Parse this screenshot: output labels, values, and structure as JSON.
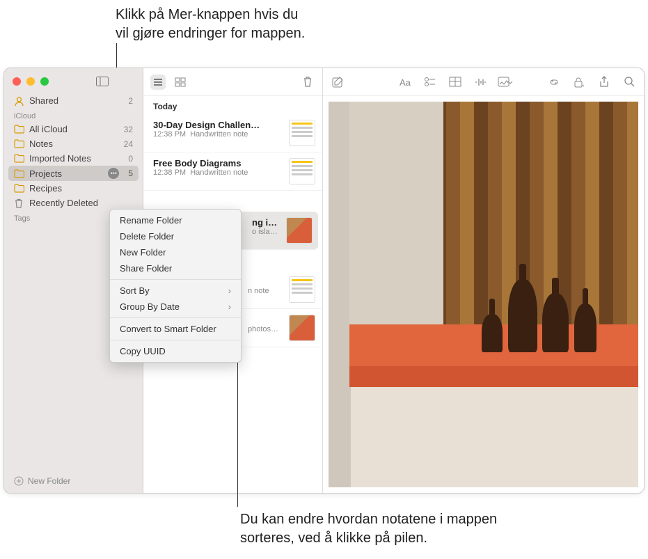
{
  "callouts": {
    "top": "Klikk på Mer-knappen hvis du\nvil gjøre endringer for mappen.",
    "bottom": "Du kan endre hvordan notatene i mappen\nsorteres, ved å klikke på pilen."
  },
  "sidebar": {
    "shared": {
      "label": "Shared",
      "count": "2"
    },
    "section_icloud": "iCloud",
    "items": [
      {
        "label": "All iCloud",
        "count": "32"
      },
      {
        "label": "Notes",
        "count": "24"
      },
      {
        "label": "Imported Notes",
        "count": "0"
      },
      {
        "label": "Projects",
        "count": "5"
      },
      {
        "label": "Recipes",
        "count": ""
      },
      {
        "label": "Recently Deleted",
        "count": ""
      }
    ],
    "section_tags": "Tags",
    "new_folder": "New Folder"
  },
  "notelist": {
    "sections": [
      {
        "label": "Today",
        "notes": [
          {
            "title": "30-Day Design Challen…",
            "time": "12:38 PM",
            "sub": "Handwritten note"
          },
          {
            "title": "Free Body Diagrams",
            "time": "12:38 PM",
            "sub": "Handwritten note"
          }
        ]
      }
    ],
    "partial_notes": [
      {
        "title_frag": "ng ideas",
        "sub_frag": "o island…"
      },
      {
        "title_frag": "",
        "sub_frag": "n note"
      },
      {
        "title_frag": "",
        "sub_frag": "photos…"
      }
    ]
  },
  "context_menu": {
    "items": [
      {
        "label": "Rename Folder",
        "arrow": false
      },
      {
        "label": "Delete Folder",
        "arrow": false
      },
      {
        "label": "New Folder",
        "arrow": false
      },
      {
        "label": "Share Folder",
        "arrow": false
      }
    ],
    "items2": [
      {
        "label": "Sort By",
        "arrow": true
      },
      {
        "label": "Group By Date",
        "arrow": true
      }
    ],
    "items3": [
      {
        "label": "Convert to Smart Folder",
        "arrow": false
      }
    ],
    "items4": [
      {
        "label": "Copy UUID",
        "arrow": false
      }
    ]
  }
}
